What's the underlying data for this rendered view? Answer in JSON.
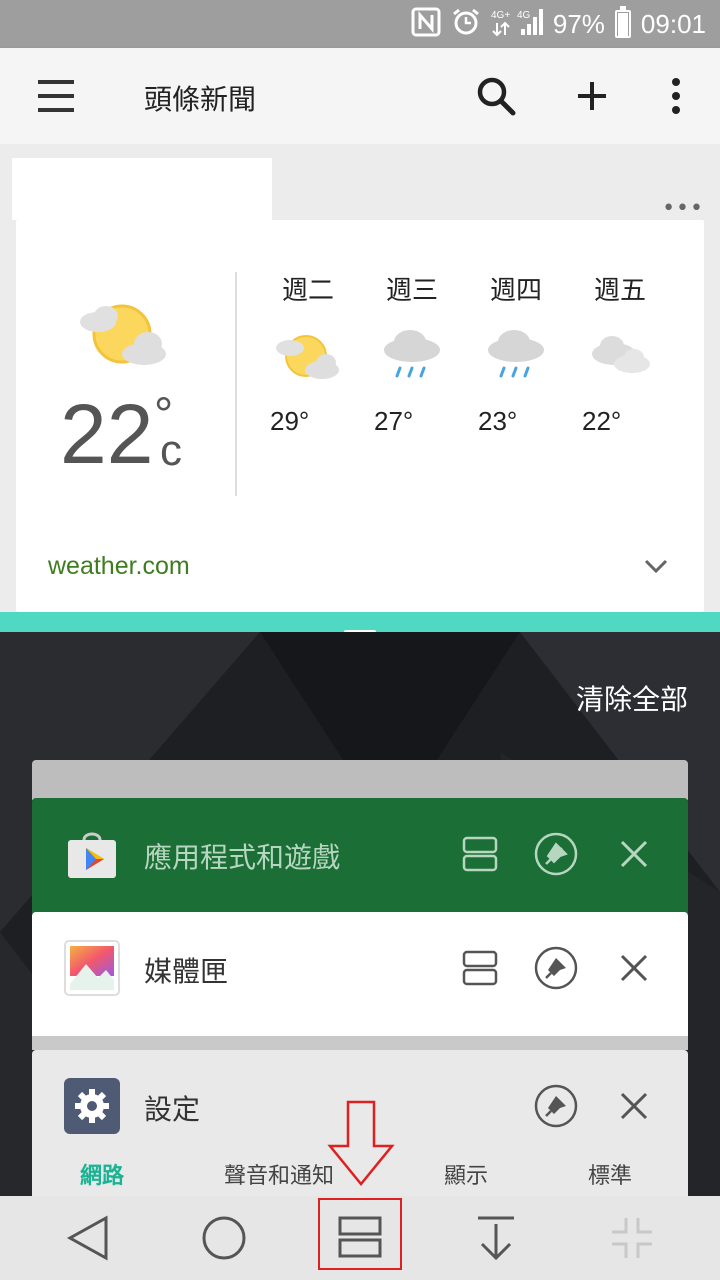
{
  "status_bar": {
    "battery": "97%",
    "time": "09:01",
    "battery_level": 0.97,
    "icons": [
      "nfc-icon",
      "alarm-icon",
      "network-4g-icon",
      "signal-icon",
      "battery-icon"
    ]
  },
  "app_bar": {
    "title": "頭條新聞",
    "icons": [
      "menu-icon",
      "search-icon",
      "add-icon",
      "overflow-icon"
    ]
  },
  "weather": {
    "current_temp": "22",
    "unit_deg": "°",
    "unit_c": "c",
    "forecast": [
      {
        "day": "週二",
        "temp": "29°",
        "icon": "partly-sunny-icon"
      },
      {
        "day": "週三",
        "temp": "27°",
        "icon": "rain-icon"
      },
      {
        "day": "週四",
        "temp": "23°",
        "icon": "rain-icon"
      },
      {
        "day": "週五",
        "temp": "22°",
        "icon": "cloudy-icon"
      }
    ],
    "source": "weather.com",
    "more": "•••"
  },
  "recents": {
    "clear_all": "清除全部",
    "cards": [
      {
        "label": "應用程式和遊戲",
        "icon": "play-store-icon"
      },
      {
        "label": "媒體匣",
        "icon": "gallery-icon"
      },
      {
        "label": "設定",
        "icon": "settings-gear-icon"
      }
    ],
    "settings_tabs": [
      "網路",
      "聲音和通知",
      "顯示",
      "標準"
    ]
  },
  "nav_bar": {
    "buttons": [
      "back-icon",
      "home-icon",
      "split-screen-icon",
      "notification-drawer-icon",
      "fullscreen-exit-icon"
    ]
  },
  "colors": {
    "accent": "#4fd9c3",
    "play_card": "#1b6e36",
    "source_link": "#3e7d1f",
    "active_tab": "#1bb394",
    "highlight": "#e02020"
  }
}
